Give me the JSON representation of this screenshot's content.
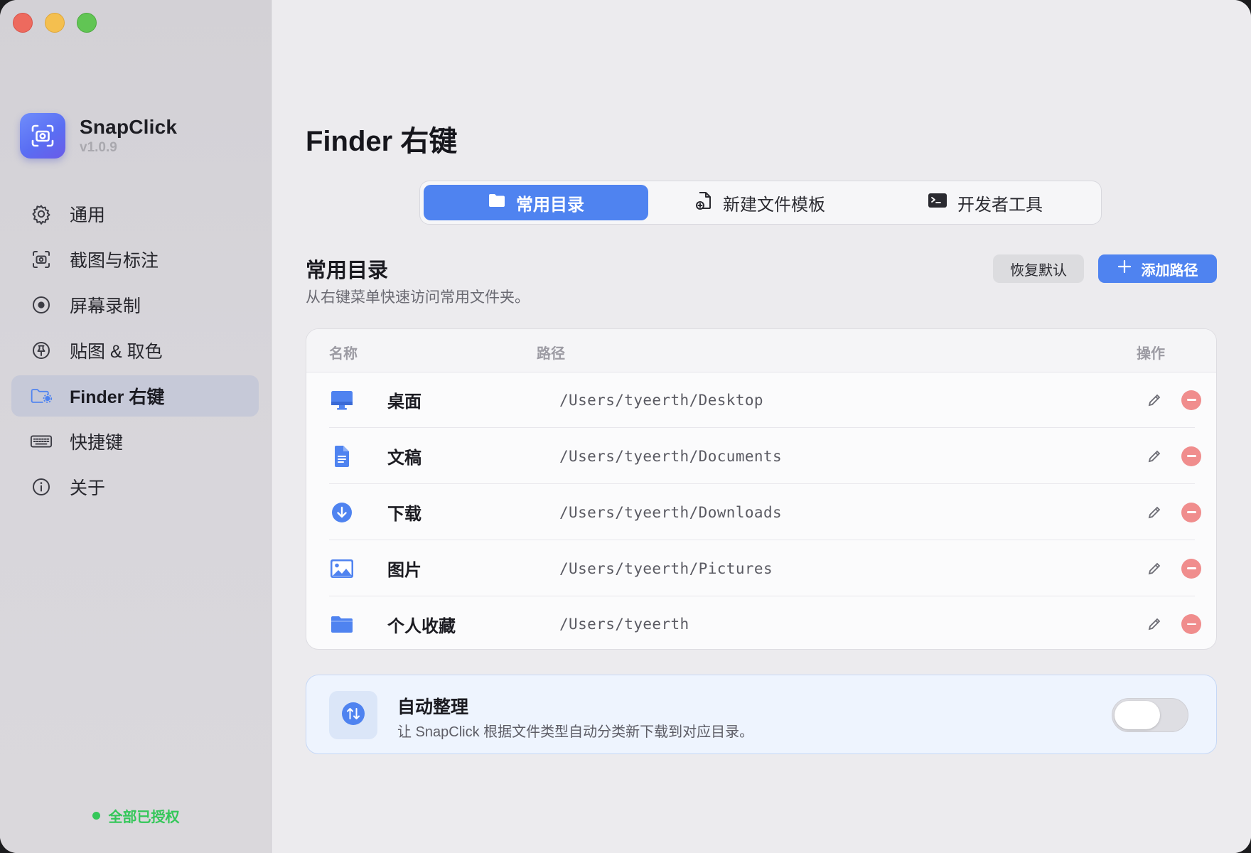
{
  "app": {
    "name": "SnapClick",
    "version": "v1.0.9"
  },
  "sidebar": {
    "items": [
      {
        "label": "通用",
        "icon": "gear-icon"
      },
      {
        "label": "截图与标注",
        "icon": "screenshot-camera-icon"
      },
      {
        "label": "屏幕录制",
        "icon": "record-icon"
      },
      {
        "label": "贴图 & 取色",
        "icon": "pin-icon"
      },
      {
        "label": "Finder 右键",
        "icon": "finder-folder-gear-icon",
        "active": true
      },
      {
        "label": "快捷键",
        "icon": "keyboard-icon"
      },
      {
        "label": "关于",
        "icon": "info-icon"
      }
    ],
    "auth_status": "全部已授权"
  },
  "page": {
    "title": "Finder 右键"
  },
  "tabs": [
    {
      "label": "常用目录",
      "icon": "folder-icon",
      "active": true
    },
    {
      "label": "新建文件模板",
      "icon": "new-file-icon"
    },
    {
      "label": "开发者工具",
      "icon": "terminal-icon"
    }
  ],
  "section": {
    "title": "常用目录",
    "description": "从右键菜单快速访问常用文件夹。",
    "reset_label": "恢复默认",
    "add_label": "添加路径"
  },
  "table": {
    "columns": {
      "name": "名称",
      "path": "路径",
      "actions": "操作"
    },
    "rows": [
      {
        "name": "桌面",
        "path": "/Users/tyeerth/Desktop",
        "icon": "desktop-icon"
      },
      {
        "name": "文稿",
        "path": "/Users/tyeerth/Documents",
        "icon": "document-icon"
      },
      {
        "name": "下载",
        "path": "/Users/tyeerth/Downloads",
        "icon": "download-icon"
      },
      {
        "name": "图片",
        "path": "/Users/tyeerth/Pictures",
        "icon": "picture-icon"
      },
      {
        "name": "个人收藏",
        "path": "/Users/tyeerth",
        "icon": "folder-icon"
      }
    ]
  },
  "auto_organize": {
    "title": "自动整理",
    "description": "让 SnapClick 根据文件类型自动分类新下载到对应目录。",
    "enabled": false
  },
  "colors": {
    "accent": "#4f83f0",
    "delete": "#f08d8d",
    "authorized": "#34c759"
  }
}
